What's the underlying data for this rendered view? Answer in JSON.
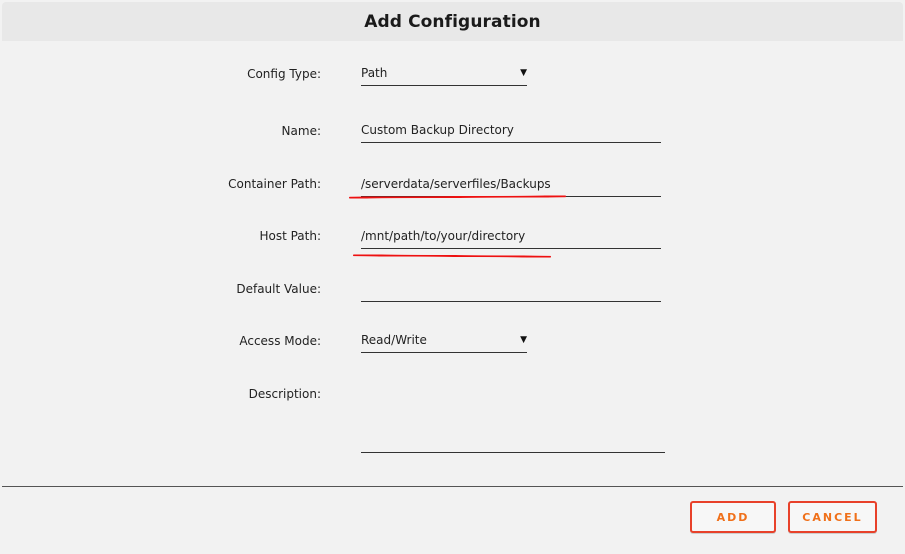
{
  "dialog": {
    "title": "Add Configuration"
  },
  "form": {
    "config_type": {
      "label": "Config Type:",
      "value": "Path"
    },
    "name": {
      "label": "Name:",
      "value": "Custom Backup Directory"
    },
    "container_path": {
      "label": "Container Path:",
      "value": "/serverdata/serverfiles/Backups"
    },
    "host_path": {
      "label": "Host Path:",
      "value": "/mnt/path/to/your/directory"
    },
    "default_value": {
      "label": "Default Value:",
      "value": ""
    },
    "access_mode": {
      "label": "Access Mode:",
      "value": "Read/Write"
    },
    "description": {
      "label": "Description:",
      "value": ""
    }
  },
  "buttons": {
    "add": "ADD",
    "cancel": "CANCEL"
  },
  "icons": {
    "select_arrow": "▼"
  },
  "colors": {
    "annotation_underline": "#ee1111",
    "button_border": "#e8412a",
    "button_text": "#f0701a"
  }
}
